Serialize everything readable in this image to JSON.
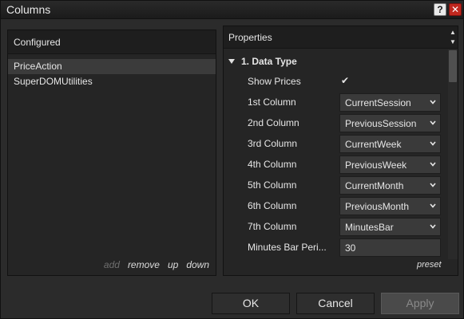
{
  "window": {
    "title": "Columns",
    "help_label": "?",
    "close_label": "✕"
  },
  "left": {
    "header": "Configured",
    "items": [
      "PriceAction",
      "SuperDOMUtilities"
    ],
    "actions": {
      "add": "add",
      "remove": "remove",
      "up": "up",
      "down": "down"
    }
  },
  "right": {
    "header": "Properties",
    "section": "1. Data Type",
    "show_prices": {
      "label": "Show Prices",
      "checked": true,
      "mark": "✔"
    },
    "columns": [
      {
        "label": "1st Column",
        "value": "CurrentSession"
      },
      {
        "label": "2nd Column",
        "value": "PreviousSession"
      },
      {
        "label": "3rd Column",
        "value": "CurrentWeek"
      },
      {
        "label": "4th Column",
        "value": "PreviousWeek"
      },
      {
        "label": "5th Column",
        "value": "CurrentMonth"
      },
      {
        "label": "6th Column",
        "value": "PreviousMonth"
      },
      {
        "label": "7th Column",
        "value": "MinutesBar"
      }
    ],
    "minutes_bar_period": {
      "label": "Minutes Bar Peri...",
      "value": "30"
    },
    "preset": "preset"
  },
  "buttons": {
    "ok": "OK",
    "cancel": "Cancel",
    "apply": "Apply"
  },
  "colors": {
    "close": "#c0281f",
    "background": "#2b2b2b",
    "panel": "#252525",
    "header": "#1e1e1e",
    "field": "#3a3a3a"
  },
  "icons": {
    "help": "help-icon",
    "close": "close-icon",
    "collapse": "triangle-down-icon",
    "dropdown": "chevron-down-icon",
    "check": "checkmark-icon"
  }
}
